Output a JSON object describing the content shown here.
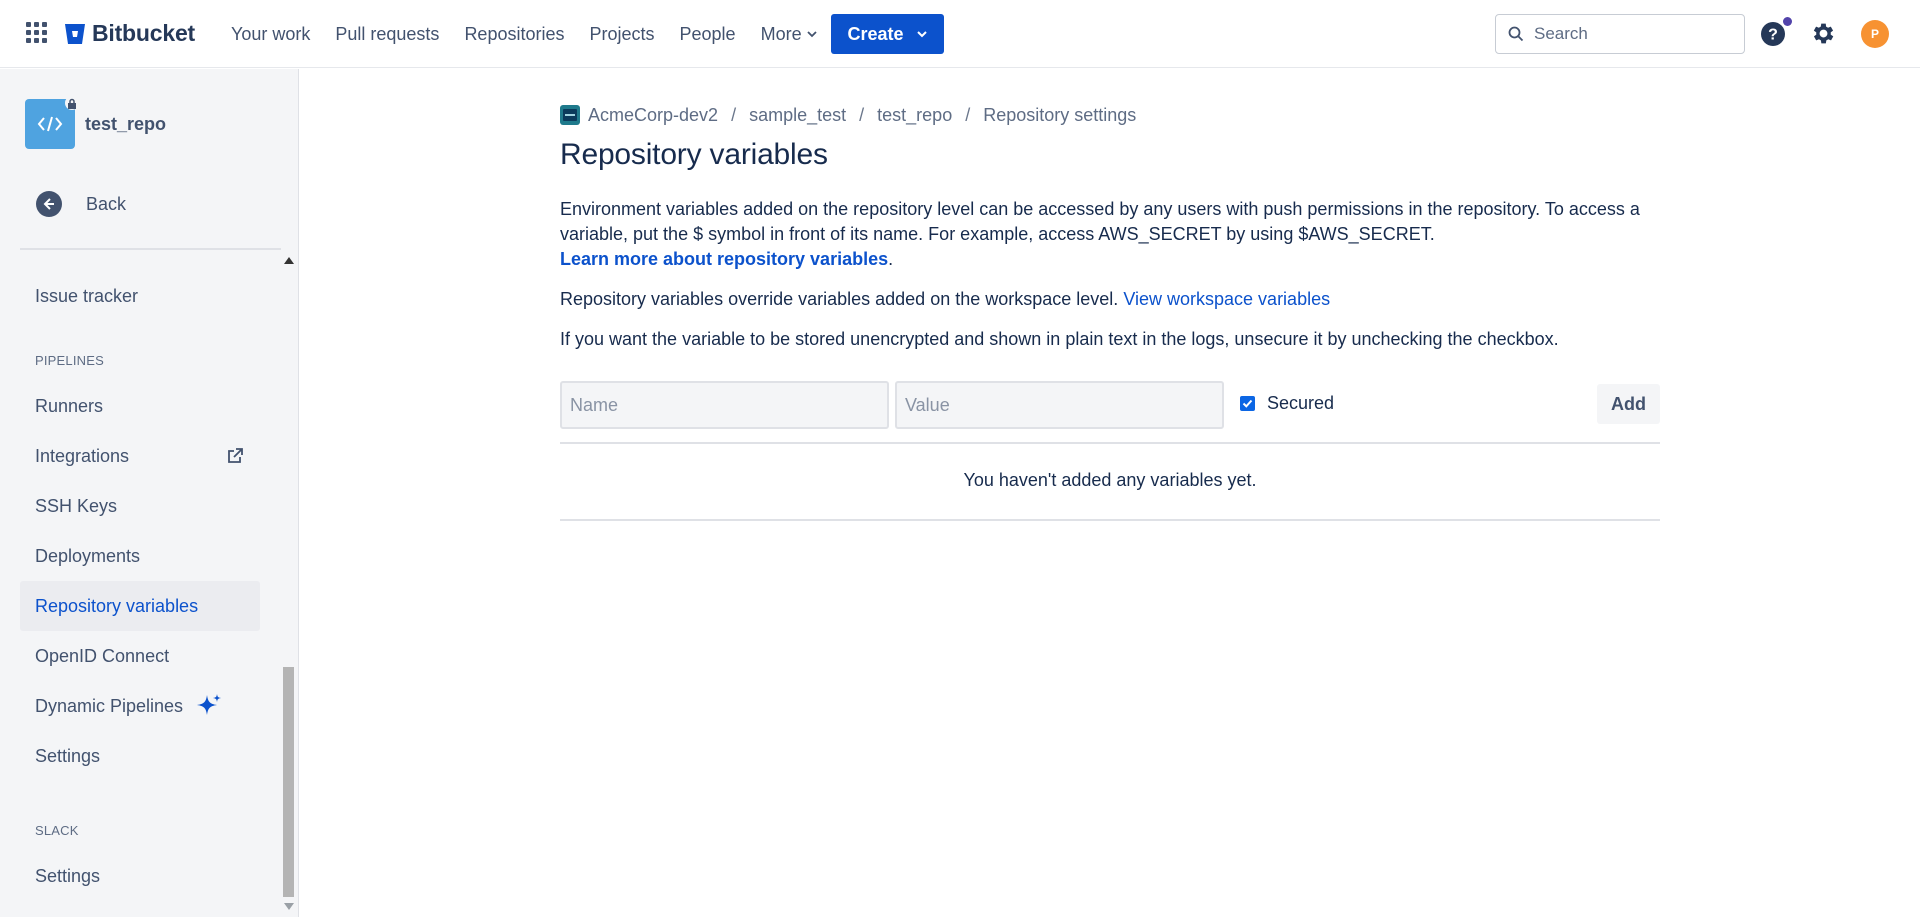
{
  "app": {
    "name": "Bitbucket"
  },
  "nav": {
    "links": [
      "Your work",
      "Pull requests",
      "Repositories",
      "Projects",
      "People"
    ],
    "more_label": "More",
    "create_label": "Create",
    "search_placeholder": "Search",
    "avatar_initial": "P"
  },
  "sidebar": {
    "repo_name": "test_repo",
    "back_label": "Back",
    "issue_tracker": "Issue tracker",
    "pipelines_header": "PIPELINES",
    "runners": "Runners",
    "integrations": "Integrations",
    "ssh_keys": "SSH Keys",
    "deployments": "Deployments",
    "repository_variables": "Repository variables",
    "openid_connect": "OpenID Connect",
    "dynamic_pipelines": "Dynamic Pipelines",
    "settings": "Settings",
    "slack_header": "SLACK",
    "slack_settings": "Settings"
  },
  "breadcrumb": {
    "workspace": "AcmeCorp-dev2",
    "project": "sample_test",
    "repo": "test_repo",
    "current": "Repository settings",
    "separator": "/"
  },
  "main": {
    "title": "Repository variables",
    "desc_text": "Environment variables added on the repository level can be accessed by any users with push permissions in the repository. To access a variable, put the $ symbol in front of its name. For example, access AWS_SECRET by using $AWS_SECRET.",
    "learn_more_link": "Learn more about repository variables",
    "learn_more_suffix": ".",
    "override_text": "Repository variables override variables added on the workspace level.",
    "workspace_link": "View workspace variables",
    "unencrypted_text": "If you want the variable to be stored unencrypted and shown in plain text in the logs, unsecure it by unchecking the checkbox.",
    "name_placeholder": "Name",
    "value_placeholder": "Value",
    "secured_label": "Secured",
    "add_label": "Add",
    "empty_message": "You haven't added any variables yet."
  },
  "colors": {
    "brand_blue": "#0c52cc",
    "repo_avatar": "#4fa3e0",
    "avatar_orange": "#f79232",
    "notification_dot": "#5243aa"
  }
}
